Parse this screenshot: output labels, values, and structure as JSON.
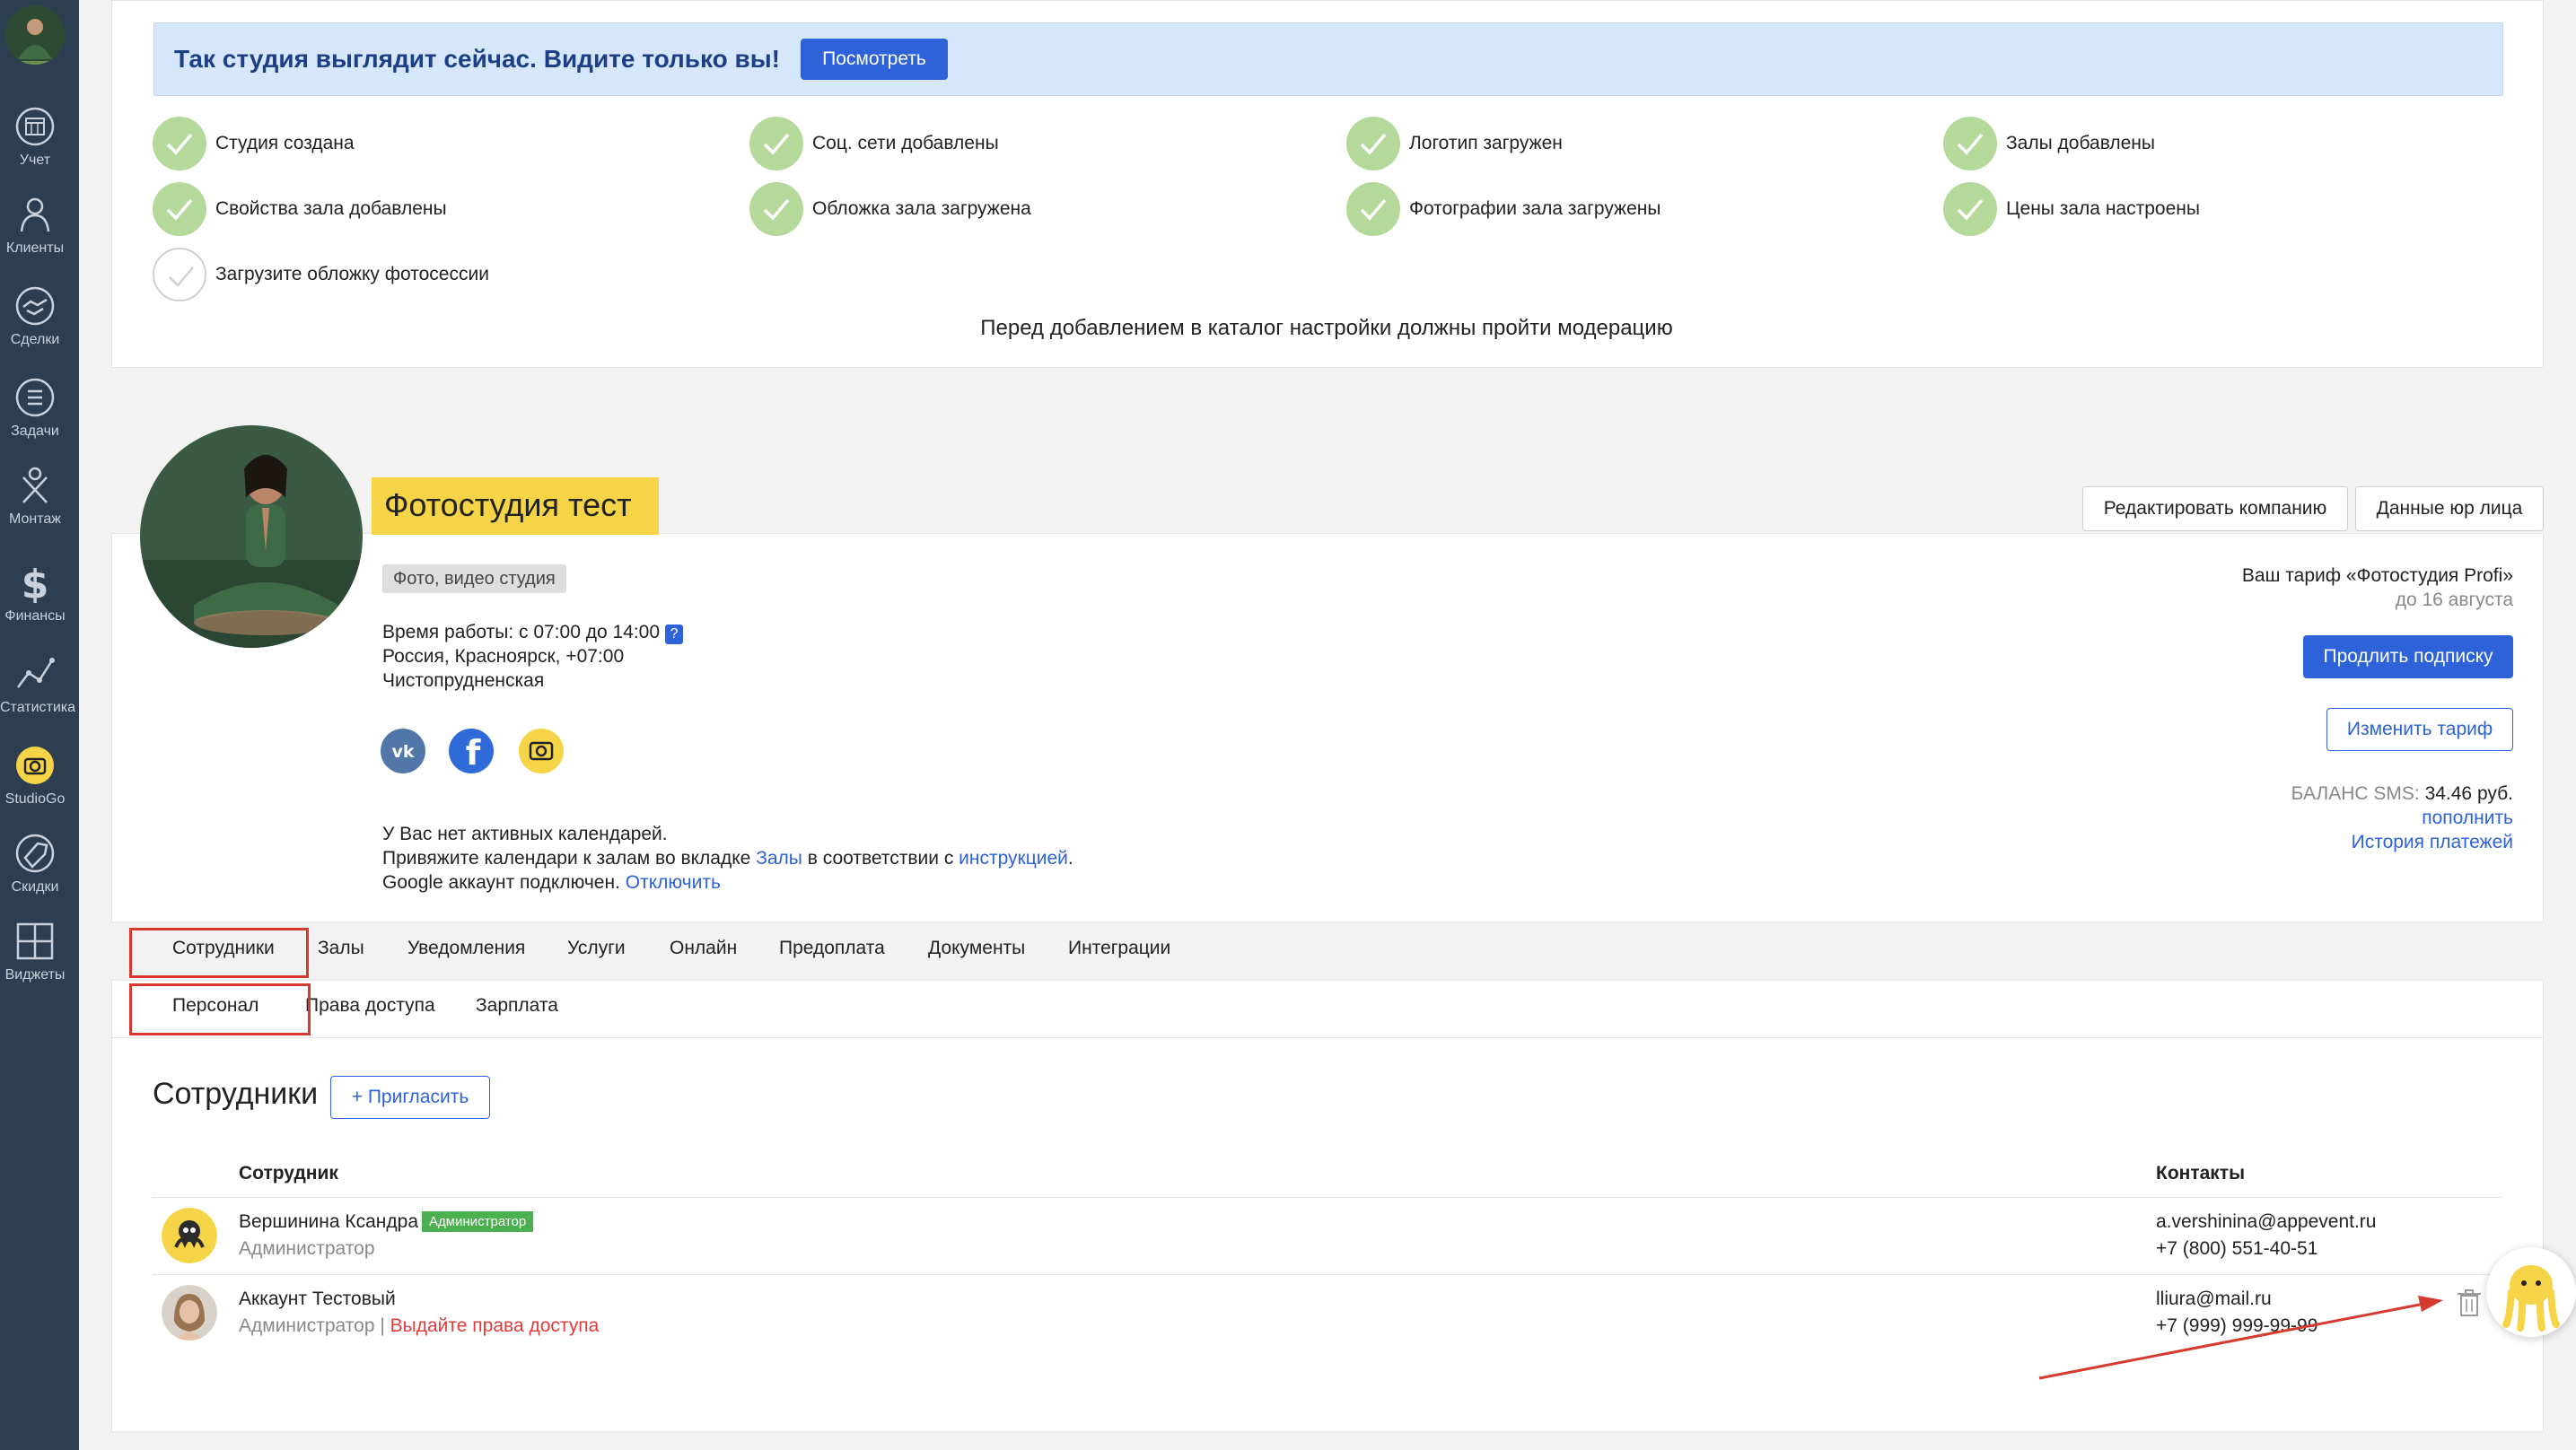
{
  "sidebar": {
    "items": [
      {
        "label": "Учет",
        "icon": "calendar-icon"
      },
      {
        "label": "Клиенты",
        "icon": "clients-icon"
      },
      {
        "label": "Сделки",
        "icon": "handshake-icon"
      },
      {
        "label": "Задачи",
        "icon": "tasks-icon"
      },
      {
        "label": "Монтаж",
        "icon": "montage-icon"
      },
      {
        "label": "Финансы",
        "icon": "dollar-icon"
      },
      {
        "label": "Статистика",
        "icon": "chart-icon"
      },
      {
        "label": "StudioGo",
        "icon": "camera-icon"
      },
      {
        "label": "Скидки",
        "icon": "sale-tag-icon"
      },
      {
        "label": "Виджеты",
        "icon": "widgets-icon"
      }
    ]
  },
  "banner": {
    "text": "Так студия выглядит сейчас. Видите только вы!",
    "button": "Посмотреть"
  },
  "checklist": [
    {
      "label": "Студия создана",
      "done": true
    },
    {
      "label": "Соц. сети добавлены",
      "done": true
    },
    {
      "label": "Логотип загружен",
      "done": true
    },
    {
      "label": "Залы добавлены",
      "done": true
    },
    {
      "label": "Свойства зала добавлены",
      "done": true
    },
    {
      "label": "Обложка зала загружена",
      "done": true
    },
    {
      "label": "Фотографии зала загружены",
      "done": true
    },
    {
      "label": "Цены зала настроены",
      "done": true
    },
    {
      "label": "Загрузите обложку фотосессии",
      "done": false
    }
  ],
  "moderation_note": "Перед добавлением в каталог настройки должны пройти модерацию",
  "company": {
    "name": "Фотостудия тест",
    "edit_button": "Редактировать компанию",
    "legal_button": "Данные юр лица",
    "tag": "Фото, видео студия",
    "hours": "Время работы: с 07:00 до 14:00",
    "help_mark": "?",
    "location": "Россия, Красноярск, +07:00",
    "street": "Чистопрудненская",
    "calendars_line1": "У Вас нет активных календарей.",
    "calendars_line2_pre": "Привяжите календари к залам во вкладке ",
    "calendars_link_halls": "Залы",
    "calendars_line2_mid": " в соответствии с ",
    "calendars_link_instr": "инструкцией",
    "calendars_line2_end": ".",
    "google_pre": "Google аккаунт подключен. ",
    "google_link": "Отключить"
  },
  "tariff": {
    "label": "Ваш тариф «Фотостудия Profi»",
    "until": "до 16 августа",
    "extend_button": "Продлить подписку",
    "change_button": "Изменить тариф",
    "sms_label": "БАЛАНС SMS: ",
    "sms_value": "34.46 руб.",
    "topup_link": "пополнить",
    "history_link": "История платежей"
  },
  "tabs": [
    "Сотрудники",
    "Залы",
    "Уведомления",
    "Услуги",
    "Онлайн",
    "Предоплата",
    "Документы",
    "Интеграции"
  ],
  "subtabs": [
    "Персонал",
    "Права доступа",
    "Зарплата"
  ],
  "staff": {
    "title": "Сотрудники",
    "invite_button": "+ Пригласить",
    "col_employee": "Сотрудник",
    "col_contacts": "Контакты",
    "rows": [
      {
        "name": "Вершинина Ксандра",
        "badge": "Администратор",
        "role": "Администратор",
        "email": "a.vershinina@appevent.ru",
        "phone": "+7 (800) 551-40-51"
      },
      {
        "name": "Аккаунт Тестовый",
        "role": "Администратор",
        "sep": " | ",
        "grant_link": "Выдайте права доступа",
        "email": "lliura@mail.ru",
        "phone": "+7 (999) 999-99-99"
      }
    ]
  },
  "colors": {
    "sidebar": "#2d3e50",
    "accent_blue": "#2d62d9",
    "title_yellow": "#f5d547",
    "check_green": "#b5d99b",
    "highlight_red": "#d63a2e"
  }
}
